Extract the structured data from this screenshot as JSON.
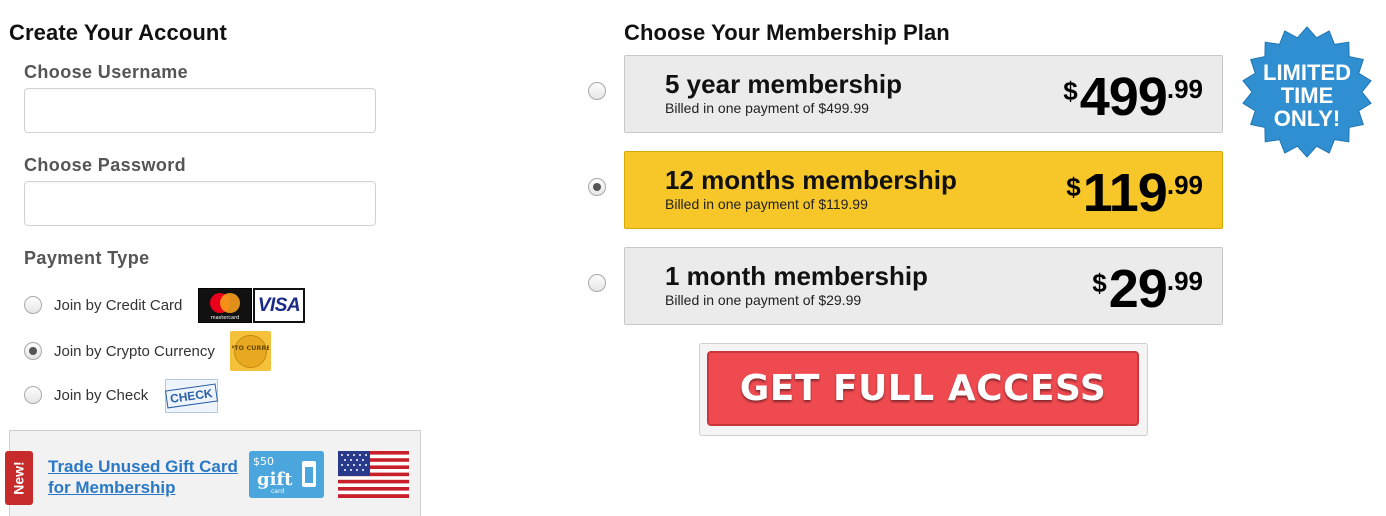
{
  "account": {
    "title": "Create Your Account",
    "username_label": "Choose Username",
    "username_value": "",
    "password_label": "Choose Password",
    "password_value": ""
  },
  "payment": {
    "title": "Payment Type",
    "options": [
      {
        "label": "Join by Credit Card",
        "selected": false
      },
      {
        "label": "Join by Crypto Currency",
        "selected": true
      },
      {
        "label": "Join by Check",
        "selected": false
      }
    ],
    "visa_text": "VISA",
    "mastercard_text": "mastercard",
    "crypto_badge_text": "CRYPTO CURRENCY",
    "check_badge_text": "CHECK"
  },
  "gift": {
    "new_tag": "New!",
    "link_text": "Trade Unused Gift Card for Membership",
    "card_amount": "$50",
    "card_word": "gift",
    "card_sub": "card"
  },
  "plans": {
    "title": "Choose Your Membership Plan",
    "items": [
      {
        "name": "5 year membership",
        "sub": "Billed in one payment of $499.99",
        "currency": "$",
        "price_main": "499",
        "price_cents": ".99",
        "selected": false
      },
      {
        "name": "12 months membership",
        "sub": "Billed in one payment of $119.99",
        "currency": "$",
        "price_main": "119",
        "price_cents": ".99",
        "selected": true
      },
      {
        "name": "1 month membership",
        "sub": "Billed in one payment of $29.99",
        "currency": "$",
        "price_main": "29",
        "price_cents": ".99",
        "selected": false
      }
    ]
  },
  "badge": {
    "line1": "LIMITED",
    "line2": "TIME",
    "line3": "ONLY!"
  },
  "cta": {
    "label": "GET FULL ACCESS"
  },
  "colors": {
    "selected_plan": "#f7c72a",
    "plan_bg": "#ebebeb",
    "cta": "#ef4a50",
    "badge_blue": "#2f8fd0",
    "link": "#2a78c6"
  }
}
